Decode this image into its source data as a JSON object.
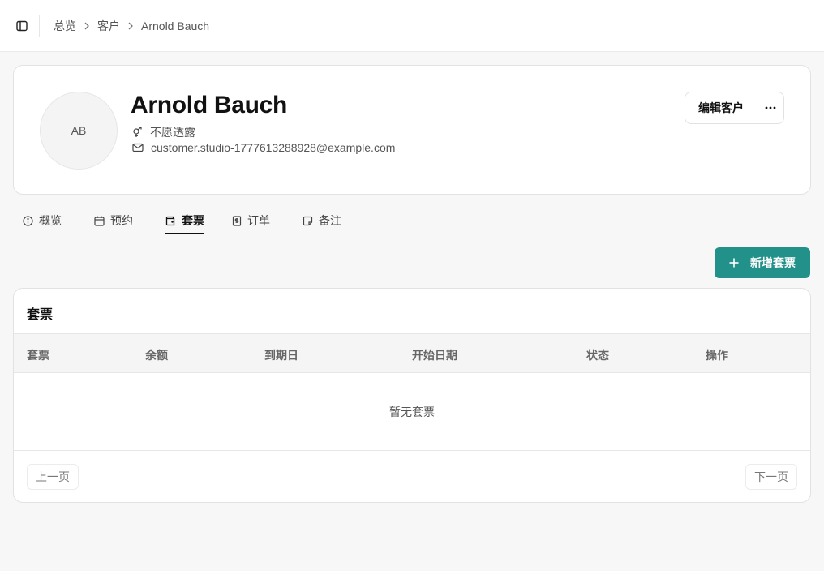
{
  "header": {
    "breadcrumb": [
      "总览",
      "客户",
      "Arnold Bauch"
    ]
  },
  "profile": {
    "avatar_initials": "AB",
    "name": "Arnold Bauch",
    "gender": "不愿透露",
    "email": "customer.studio-1777613288928@example.com",
    "edit_label": "编辑客户"
  },
  "tabs": [
    {
      "label": "概览",
      "icon": "info-icon"
    },
    {
      "label": "预约",
      "icon": "calendar-icon"
    },
    {
      "label": "套票",
      "icon": "wallet-icon",
      "active": true
    },
    {
      "label": "订单",
      "icon": "receipt-icon"
    },
    {
      "label": "备注",
      "icon": "note-icon"
    }
  ],
  "add_button": {
    "label": "新增套票"
  },
  "passes_table": {
    "title": "套票",
    "columns": [
      "套票",
      "余额",
      "到期日",
      "开始日期",
      "状态",
      "操作"
    ],
    "empty_text": "暂无套票",
    "prev_label": "上一页",
    "next_label": "下一页"
  },
  "colors": {
    "accent": "#22918a",
    "background": "#f7f7f7"
  }
}
